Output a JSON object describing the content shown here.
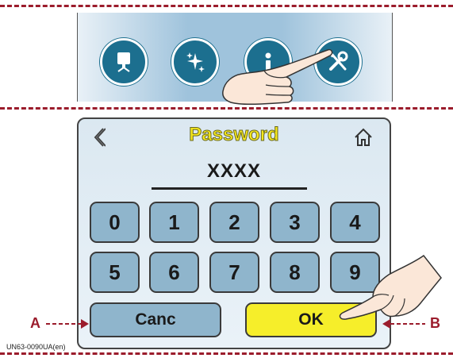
{
  "menu": {
    "items": [
      {
        "icon": "display-icon"
      },
      {
        "icon": "sparkles-icon"
      },
      {
        "icon": "info-icon"
      },
      {
        "icon": "tools-icon"
      }
    ]
  },
  "screen": {
    "title": "Password",
    "password_value": "XXXX",
    "keypad": [
      "0",
      "1",
      "2",
      "3",
      "4",
      "5",
      "6",
      "7",
      "8",
      "9"
    ],
    "cancel_label": "Canc",
    "ok_label": "OK"
  },
  "callouts": {
    "a": "A",
    "b": "B"
  },
  "caption": "UN63-0090UA(en)",
  "colors": {
    "accent_yellow": "#f6e81c",
    "key_blue": "#8fb5cc",
    "ok_yellow": "#f6ee2a",
    "icon_teal": "#1c6f8f",
    "dash_red": "#9b1c2c"
  }
}
